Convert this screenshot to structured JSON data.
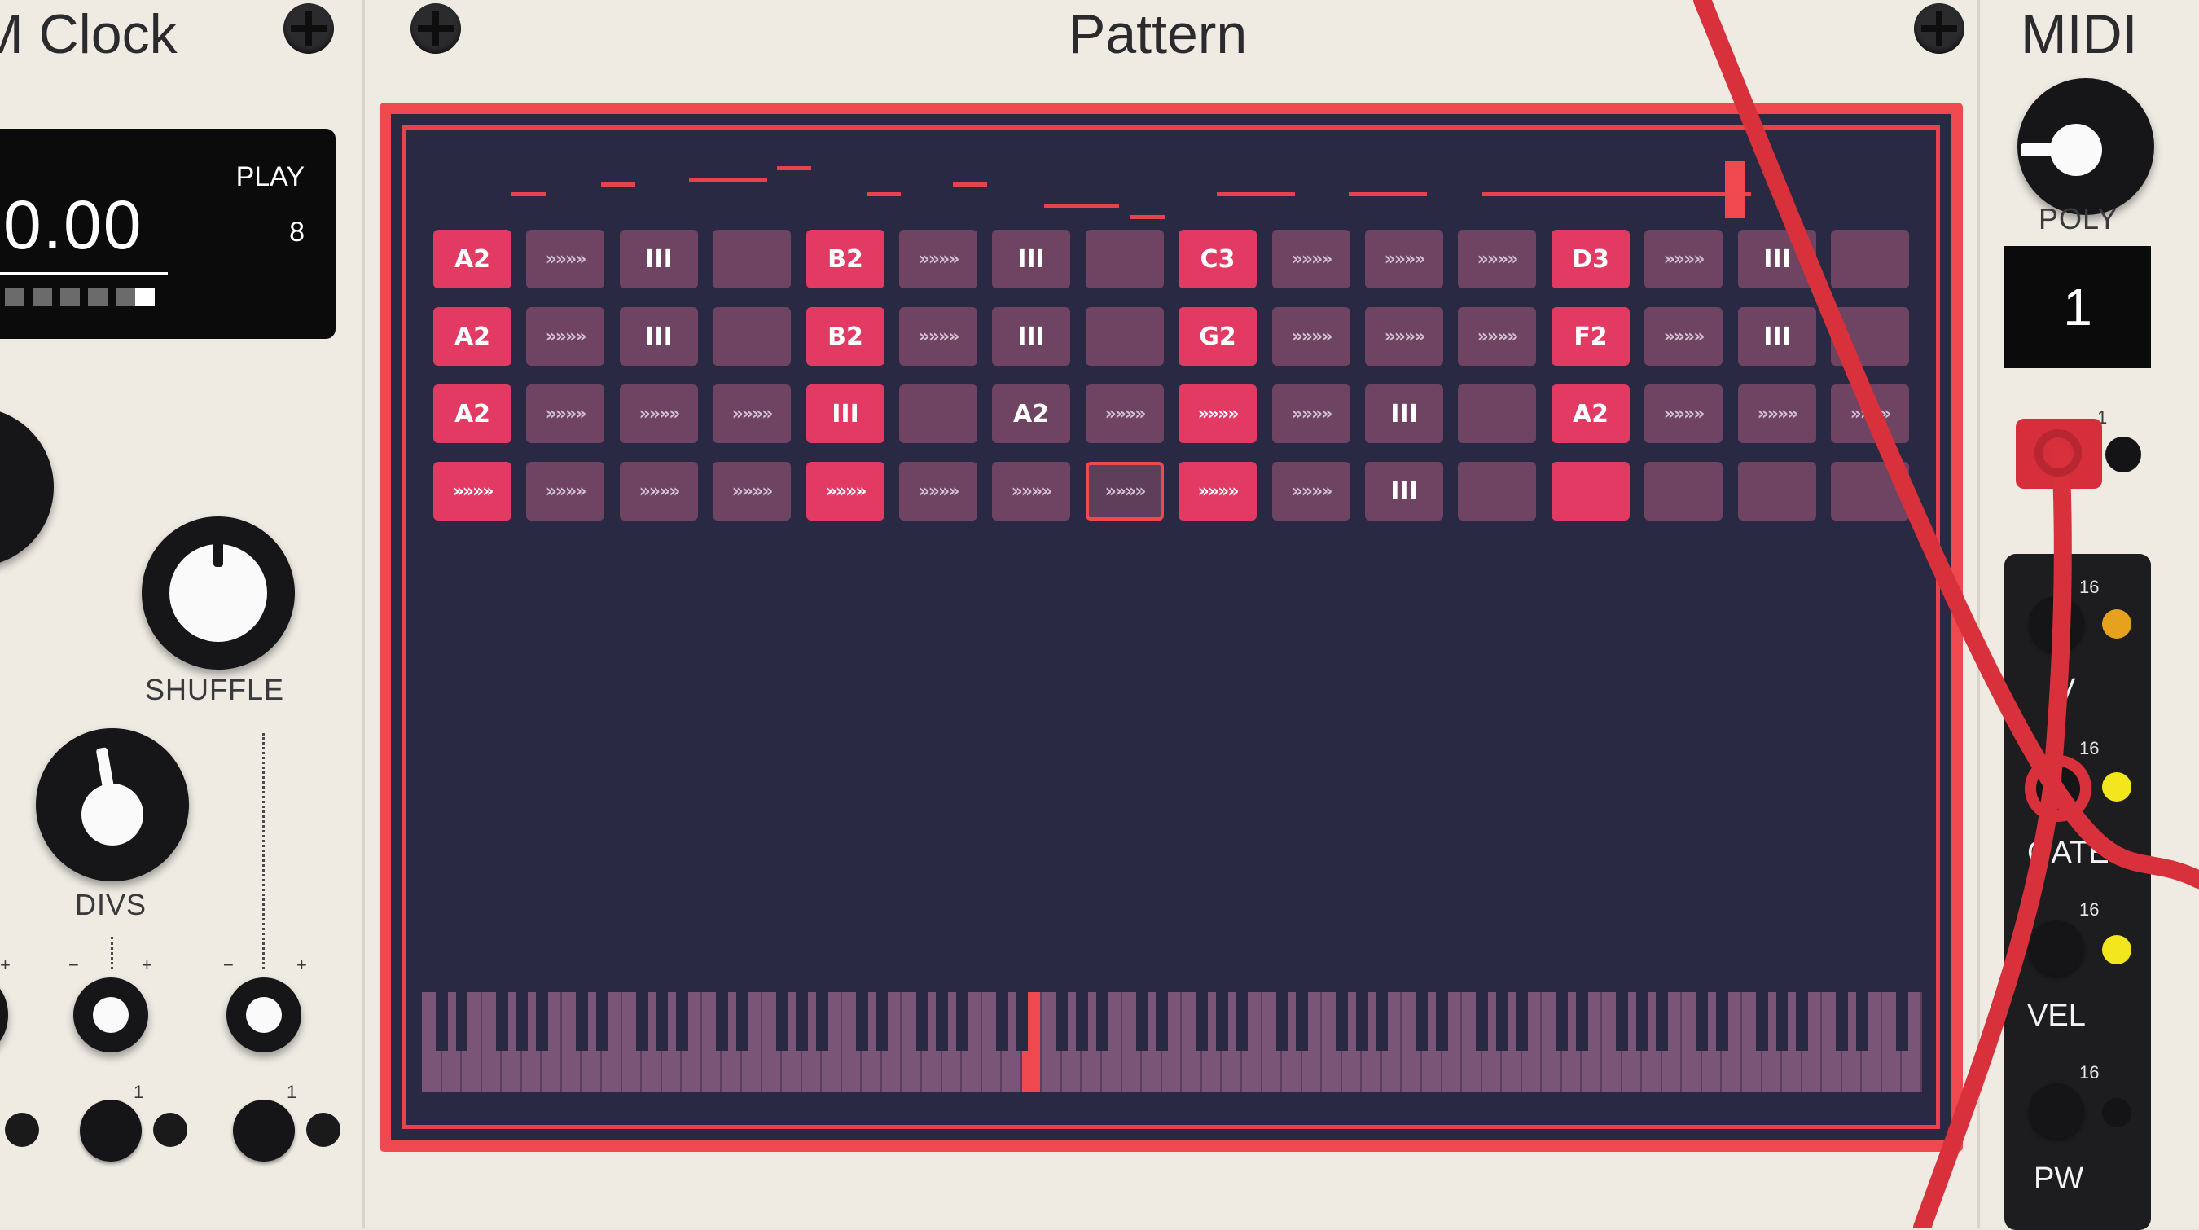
{
  "clock_module": {
    "title": "M Clock",
    "display": {
      "value": "0.00",
      "state": "PLAY",
      "count": "8"
    },
    "shuffle_label": "SHUFFLE",
    "divs_label": "DIVS",
    "minus": "−",
    "plus": "+",
    "port_number": "1"
  },
  "pattern_module": {
    "title": "Pattern",
    "grid": [
      [
        {
          "t": "note",
          "v": "A2"
        },
        {
          "t": "tie",
          "v": "»»»»"
        },
        {
          "t": "rest",
          "v": "III"
        },
        {
          "t": "empty",
          "v": ""
        },
        {
          "t": "note",
          "v": "B2"
        },
        {
          "t": "tie",
          "v": "»»»»"
        },
        {
          "t": "rest",
          "v": "III"
        },
        {
          "t": "empty",
          "v": ""
        },
        {
          "t": "note",
          "v": "C3"
        },
        {
          "t": "tie",
          "v": "»»»»"
        },
        {
          "t": "tie",
          "v": "»»»»"
        },
        {
          "t": "tie",
          "v": "»»»»"
        },
        {
          "t": "note",
          "v": "D3"
        },
        {
          "t": "tie",
          "v": "»»»»"
        },
        {
          "t": "rest",
          "v": "III"
        },
        {
          "t": "empty",
          "v": ""
        }
      ],
      [
        {
          "t": "note",
          "v": "A2"
        },
        {
          "t": "tie",
          "v": "»»»»"
        },
        {
          "t": "rest",
          "v": "III"
        },
        {
          "t": "empty",
          "v": ""
        },
        {
          "t": "note",
          "v": "B2"
        },
        {
          "t": "tie",
          "v": "»»»»"
        },
        {
          "t": "rest",
          "v": "III"
        },
        {
          "t": "empty",
          "v": ""
        },
        {
          "t": "note",
          "v": "G2"
        },
        {
          "t": "tie",
          "v": "»»»»"
        },
        {
          "t": "tie",
          "v": "»»»»"
        },
        {
          "t": "tie",
          "v": "»»»»"
        },
        {
          "t": "note",
          "v": "F2"
        },
        {
          "t": "tie",
          "v": "»»»»"
        },
        {
          "t": "rest",
          "v": "III"
        },
        {
          "t": "empty",
          "v": ""
        }
      ],
      [
        {
          "t": "note",
          "v": "A2"
        },
        {
          "t": "tie",
          "v": "»»»»"
        },
        {
          "t": "tie",
          "v": "»»»»"
        },
        {
          "t": "tie",
          "v": "»»»»"
        },
        {
          "t": "note",
          "v": "III"
        },
        {
          "t": "empty",
          "v": ""
        },
        {
          "t": "plain",
          "v": "A2"
        },
        {
          "t": "tie",
          "v": "»»»»"
        },
        {
          "t": "tiehot",
          "v": "»»»»"
        },
        {
          "t": "tie",
          "v": "»»»»"
        },
        {
          "t": "rest",
          "v": "III"
        },
        {
          "t": "empty",
          "v": ""
        },
        {
          "t": "note",
          "v": "A2"
        },
        {
          "t": "tie",
          "v": "»»»»"
        },
        {
          "t": "tie",
          "v": "»»»»"
        },
        {
          "t": "tie",
          "v": "»»»»"
        }
      ],
      [
        {
          "t": "tiehot",
          "v": "»»»»"
        },
        {
          "t": "tie",
          "v": "»»»»"
        },
        {
          "t": "tie",
          "v": "»»»»"
        },
        {
          "t": "tie",
          "v": "»»»»"
        },
        {
          "t": "tiehot",
          "v": "»»»»"
        },
        {
          "t": "tie",
          "v": "»»»»"
        },
        {
          "t": "tie",
          "v": "»»»»"
        },
        {
          "t": "sel",
          "v": "»»»»"
        },
        {
          "t": "tiehot",
          "v": "»»»»"
        },
        {
          "t": "tie",
          "v": "»»»»"
        },
        {
          "t": "rest",
          "v": "III"
        },
        {
          "t": "empty",
          "v": ""
        },
        {
          "t": "note",
          "v": ""
        },
        {
          "t": "empty",
          "v": ""
        },
        {
          "t": "empty",
          "v": ""
        },
        {
          "t": "empty",
          "v": ""
        }
      ]
    ]
  },
  "midi_module": {
    "title": "MIDI",
    "poly_label": "POLY",
    "poly_value": "1",
    "port_number": "1",
    "channel_count": "16",
    "outputs": [
      "V",
      "GATE",
      "VEL",
      "PW"
    ]
  },
  "colors": {
    "accent": "#f0484f",
    "screen_bg": "#2a2944",
    "note_cell": "#e23a63",
    "idle_cell": "#6e4462",
    "cable": "#e0363f"
  }
}
